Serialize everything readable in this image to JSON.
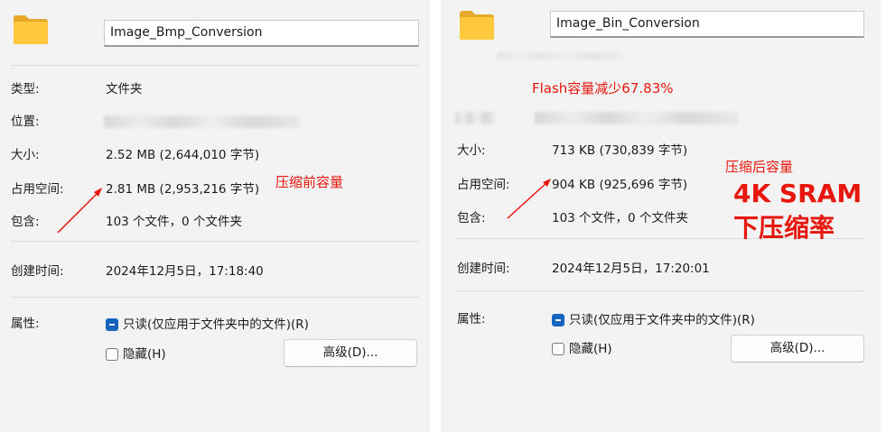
{
  "left": {
    "name": "Image_Bmp_Conversion",
    "type_label": "类型:",
    "type_value": "文件夹",
    "location_label": "位置:",
    "size_label": "大小:",
    "size_value": "2.52 MB (2,644,010 字节)",
    "disk_label": "占用空间:",
    "disk_value": "2.81 MB (2,953,216 字节)",
    "contains_label": "包含:",
    "contains_value": "103 个文件，0 个文件夹",
    "created_label": "创建时间:",
    "created_value": "2024年12月5日，17:18:40",
    "attr_label": "属性:",
    "readonly_label": "只读(仅应用于文件夹中的文件)(R)",
    "hidden_label": "隐藏(H)",
    "advanced_label": "高级(D)..."
  },
  "right": {
    "name": "Image_Bin_Conversion",
    "size_label": "大小:",
    "size_value": "713 KB (730,839 字节)",
    "disk_label": "占用空间:",
    "disk_value": "904 KB (925,696 字节)",
    "contains_label": "包含:",
    "contains_value": "103 个文件，0 个文件夹",
    "created_label": "创建时间:",
    "created_value": "2024年12月5日，17:20:01",
    "attr_label": "属性:",
    "readonly_label": "只读(仅应用于文件夹中的文件)(R)",
    "hidden_label": "隐藏(H)",
    "advanced_label": "高级(D)..."
  },
  "annotations": {
    "before_size": "压缩前容量",
    "after_size": "压缩后容量",
    "flash_reduction": "Flash容量减少67.83%",
    "sram_line1": "4K SRAM",
    "sram_line2": "下压缩率"
  },
  "colors": {
    "annotation_red": "#e8170d",
    "checkbox_blue": "#1565c0",
    "panel_bg": "#f3f3f3"
  },
  "icons": {
    "folder": "folder-icon",
    "arrow": "arrow-annotation-icon"
  }
}
